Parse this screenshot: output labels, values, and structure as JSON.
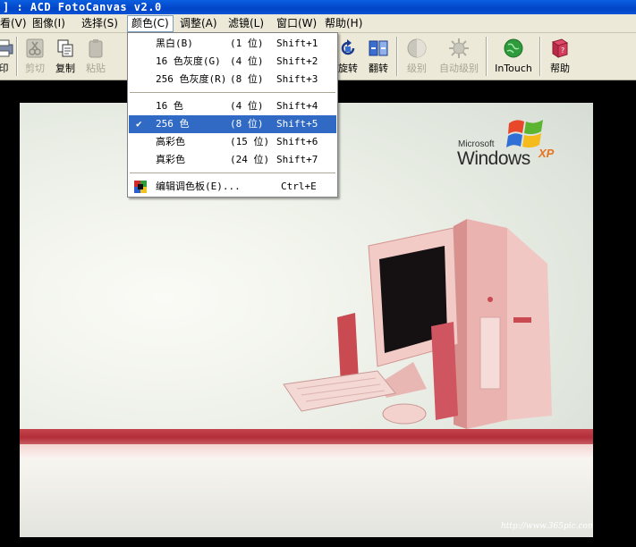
{
  "window": {
    "title": "] : ACD FotoCanvas v2.0"
  },
  "menubar": {
    "items": [
      {
        "label": "看(V)"
      },
      {
        "label": "图像(I)"
      },
      {
        "label": "选择(S)"
      },
      {
        "label": "颜色(C)"
      },
      {
        "label": "调整(A)"
      },
      {
        "label": "滤镜(L)"
      },
      {
        "label": "窗口(W)"
      },
      {
        "label": "帮助(H)"
      }
    ]
  },
  "toolbar": {
    "buttons": [
      {
        "label": "印",
        "disabled": false
      },
      {
        "label": "剪切",
        "disabled": true
      },
      {
        "label": "复制",
        "disabled": false
      },
      {
        "label": "粘贴",
        "disabled": true
      },
      {
        "label": "旋转",
        "disabled": false
      },
      {
        "label": "翻转",
        "disabled": false
      },
      {
        "label": "级别",
        "disabled": true
      },
      {
        "label": "自动级别",
        "disabled": true
      },
      {
        "label": "InTouch",
        "disabled": false
      },
      {
        "label": "帮助",
        "disabled": false
      }
    ]
  },
  "color_menu": {
    "items": [
      {
        "label": "黑白(B)",
        "bits": "(1 位)",
        "shortcut": "Shift+1",
        "checked": false,
        "highlighted": false
      },
      {
        "label": "16 色灰度(G)",
        "bits": "(4 位)",
        "shortcut": "Shift+2",
        "checked": false,
        "highlighted": false
      },
      {
        "label": "256 色灰度(R)",
        "bits": "(8 位)",
        "shortcut": "Shift+3",
        "checked": false,
        "highlighted": false
      },
      {
        "label": "16 色",
        "bits": "(4 位)",
        "shortcut": "Shift+4",
        "checked": false,
        "highlighted": false
      },
      {
        "label": "256 色",
        "bits": "(8 位)",
        "shortcut": "Shift+5",
        "checked": true,
        "highlighted": true
      },
      {
        "label": "高彩色",
        "bits": "(15 位)",
        "shortcut": "Shift+6",
        "checked": false,
        "highlighted": false
      },
      {
        "label": "真彩色",
        "bits": "(24 位)",
        "shortcut": "Shift+7",
        "checked": false,
        "highlighted": false
      },
      {
        "label": "编辑调色板(E)...",
        "bits": "",
        "shortcut": "Ctrl+E",
        "checked": false,
        "highlighted": false
      }
    ],
    "check_mark": "✔"
  },
  "image": {
    "logo_company": "Microsoft",
    "logo_product": "Windows",
    "logo_suffix": "XP",
    "watermark": "http://www.365pic.com"
  },
  "colors": {
    "menu_highlight": "#316ac5",
    "chrome": "#ece9d8",
    "titlebar": "#0245c8"
  }
}
